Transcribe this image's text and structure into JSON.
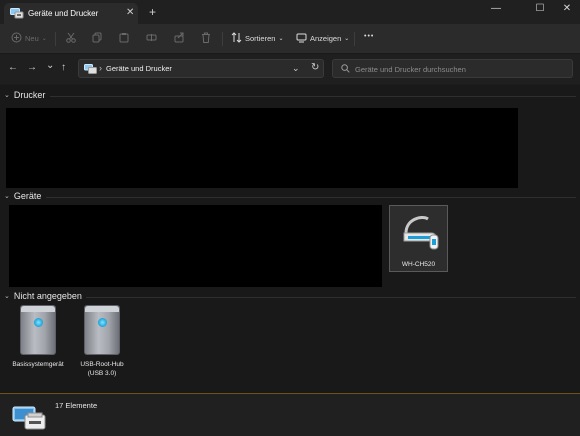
{
  "window": {
    "tab_title": "Geräte und Drucker",
    "tab_close": "✕",
    "new_tab": "+",
    "minimize": "—",
    "maximize": "☐",
    "close": "✕"
  },
  "toolbar": {
    "new_label": "Neu",
    "sort_label": "Sortieren",
    "view_label": "Anzeigen",
    "more_label": "•••",
    "icons": [
      "cut-icon",
      "copy-icon",
      "paste-icon",
      "rename-icon",
      "share-icon",
      "delete-icon"
    ]
  },
  "nav": {
    "back": "←",
    "forward": "→",
    "history": "⌄",
    "up": "↑",
    "address_sep": "›",
    "address_text": "Geräte und Drucker",
    "address_dropdown": "⌄",
    "refresh": "↻",
    "search_placeholder": "Geräte und Drucker durchsuchen"
  },
  "sections": {
    "printers": "Drucker",
    "devices": "Geräte",
    "unspecified": "Nicht angegeben",
    "chevron": "⌄"
  },
  "devices": [
    {
      "label": "WH-CH520",
      "icon": "headphone-icon"
    }
  ],
  "unspecified_devices": [
    {
      "label": "Basissystemgerät",
      "icon": "tower-icon"
    },
    {
      "label": "USB-Root-Hub\n(USB 3.0)",
      "icon": "tower-icon"
    }
  ],
  "status": {
    "count_text": "17 Elemente",
    "icon": "devices-printers-icon"
  },
  "colors": {
    "accent_blue": "#1b9fd6",
    "status_border": "#6b5516"
  }
}
